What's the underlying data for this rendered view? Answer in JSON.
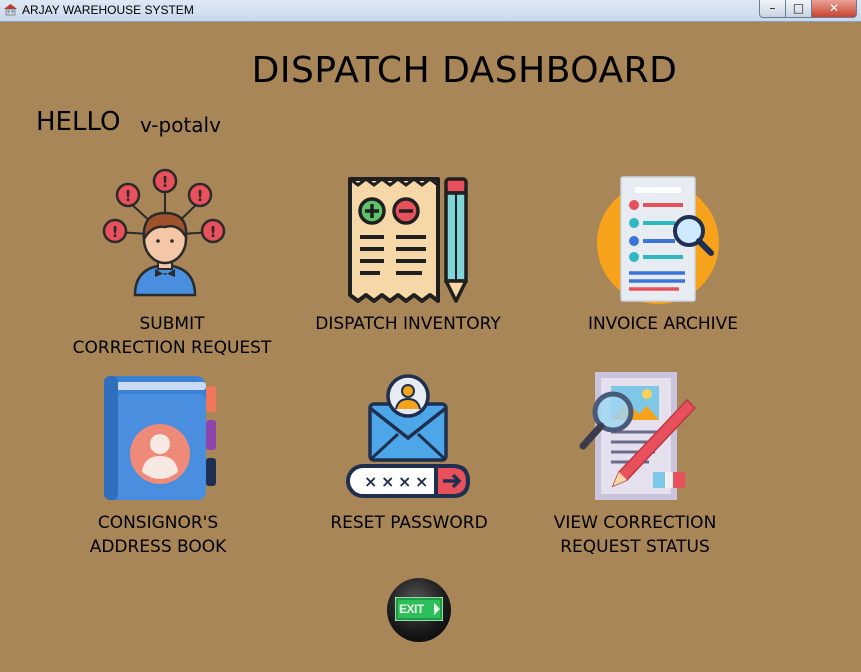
{
  "window": {
    "title": "ARJAY WAREHOUSE SYSTEM",
    "app_icon": "house-icon",
    "controls": {
      "minimize": "–",
      "maximize": "□",
      "close": "✕"
    }
  },
  "header": {
    "title": "DISPATCH DASHBOARD",
    "greeting": "HELLO",
    "username": "v-potalv"
  },
  "tiles": [
    {
      "icon": "person-with-alerts-icon",
      "line1": "SUBMIT",
      "line2": "CORRECTION REQUEST"
    },
    {
      "icon": "receipt-and-pencil-icon",
      "line1": "DISPATCH INVENTORY",
      "line2": ""
    },
    {
      "icon": "document-search-icon",
      "line1": "INVOICE ARCHIVE",
      "line2": ""
    },
    {
      "icon": "address-book-icon",
      "line1": "CONSIGNOR'S",
      "line2": "ADDRESS BOOK"
    },
    {
      "icon": "email-password-icon",
      "line1": "RESET PASSWORD",
      "line2": ""
    },
    {
      "icon": "document-edit-search-icon",
      "line1": "VIEW CORRECTION",
      "line2": "REQUEST STATUS"
    }
  ],
  "exit": {
    "label": "EXIT",
    "icon": "exit-door-icon"
  },
  "colors": {
    "background": "#a88657",
    "exit_green": "#2fbf5a"
  }
}
